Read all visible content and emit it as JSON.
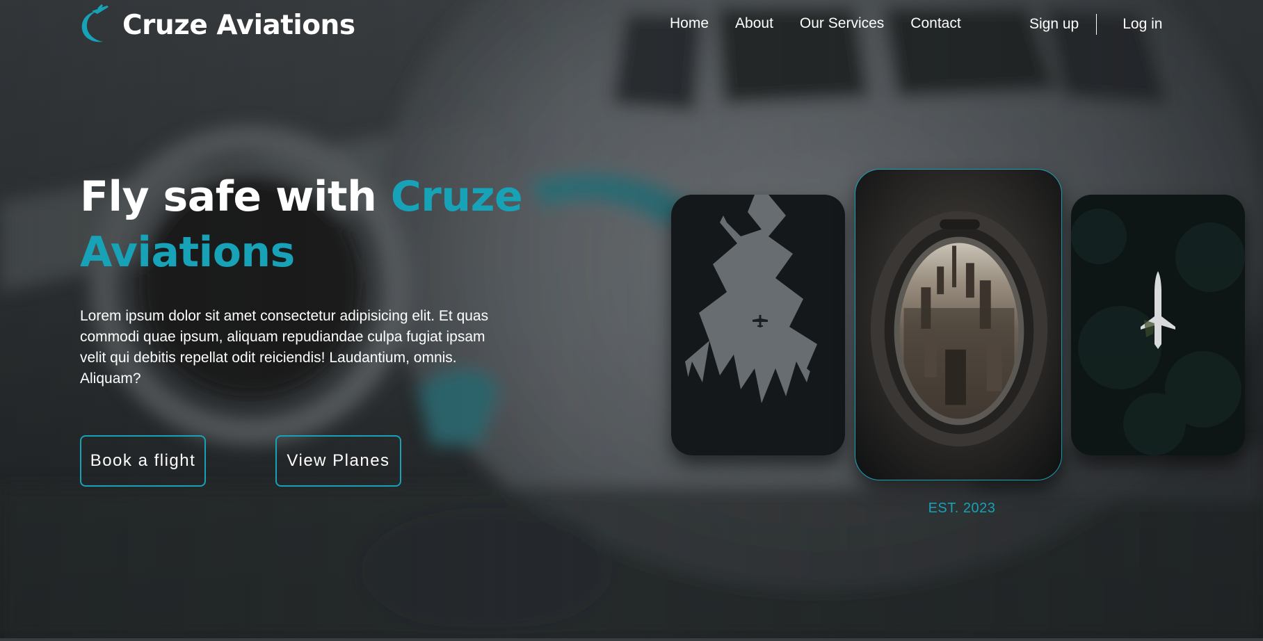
{
  "brand": {
    "name": "Cruze Aviations",
    "logo_icon": "crescent-plane-icon"
  },
  "nav": {
    "links": [
      {
        "label": "Home"
      },
      {
        "label": "About"
      },
      {
        "label": "Our Services"
      },
      {
        "label": "Contact"
      }
    ],
    "auth": {
      "signup_label": "Sign up",
      "login_label": "Log in"
    }
  },
  "hero": {
    "headline_lead": "Fly safe with",
    "headline_accent": "Cruze Aviations",
    "description": "Lorem ipsum dolor sit amet consectetur adipisicing elit. Et quas commodi quae ipsum, aliquam repudiandae culpa fugiat ipsam velit qui debitis repellat odit reiciendis! Laudantium, omnis. Aliquam?",
    "buttons": {
      "book_label": "Book a flight",
      "planes_label": "View Planes"
    }
  },
  "gallery": {
    "established": "EST. 2023"
  },
  "colors": {
    "accent": "#17a2b8",
    "text": "#ffffff",
    "background": "#34383a"
  }
}
